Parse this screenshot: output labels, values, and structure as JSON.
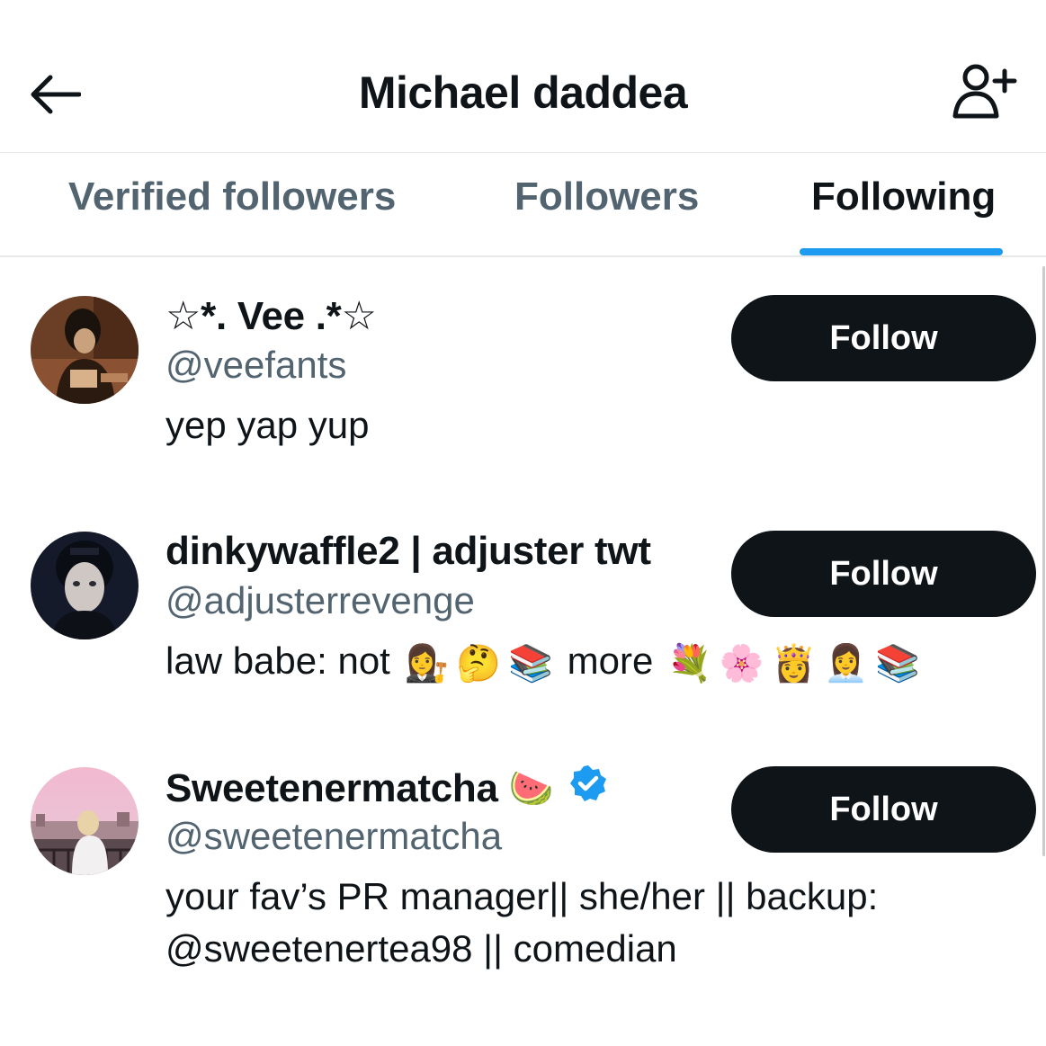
{
  "header": {
    "title": "Michael daddea",
    "back_icon": "arrow-left-icon",
    "add_user_icon": "add-user-icon"
  },
  "tabs": [
    {
      "label": "Verified followers",
      "active": false
    },
    {
      "label": "Followers",
      "active": false
    },
    {
      "label": "Following",
      "active": true
    }
  ],
  "colors": {
    "accent": "#1d9bf0",
    "text_primary": "#0f1419",
    "text_secondary": "#536471",
    "button_bg": "#0f1419",
    "button_text": "#ffffff"
  },
  "users": [
    {
      "name": "☆*. Vee .*☆",
      "handle": "@veefants",
      "bio": "yep yap yup",
      "follow_label": "Follow"
    },
    {
      "name": "dinkywaffle2 | adjuster twt",
      "handle": "@adjusterrevenge",
      "bio_prefix": "law babe: not",
      "bio_emojis_1": [
        "👩‍⚖️",
        "🤔",
        "📚"
      ],
      "bio_middle": "more",
      "bio_emojis_2": [
        "💐",
        "🌸",
        "👸",
        "👩‍💼",
        "📚"
      ],
      "follow_label": "Follow"
    },
    {
      "name": "Sweetenermatcha",
      "name_emoji": "🍉",
      "verified": true,
      "handle": "@sweetenermatcha",
      "bio_line1": "your fav’s PR manager|| she/her || backup:",
      "bio_line2": "@sweetenertea98 || comedian",
      "follow_label": "Follow"
    }
  ]
}
